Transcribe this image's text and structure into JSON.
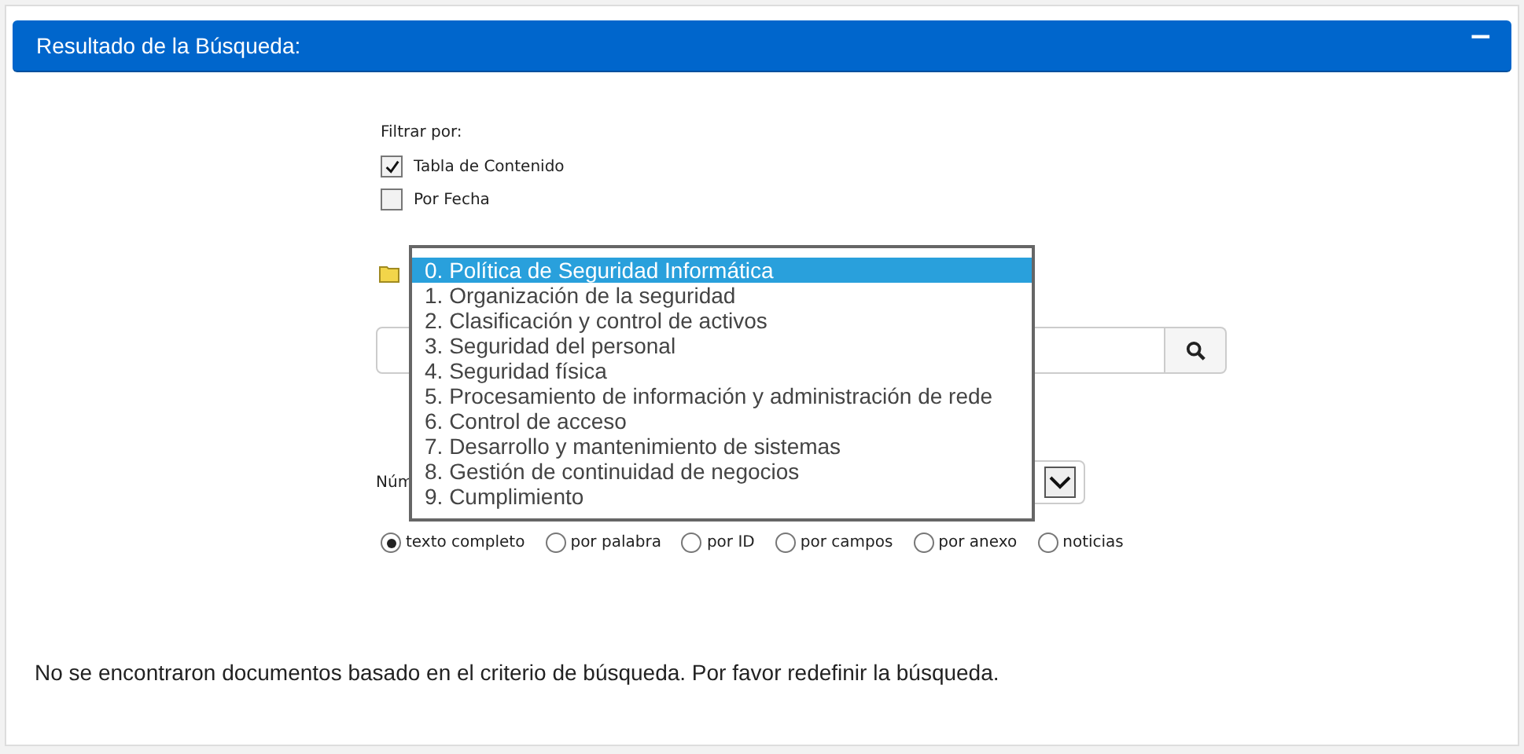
{
  "panel": {
    "title": "Resultado de la Búsqueda:",
    "collapse_icon": "−"
  },
  "filter": {
    "label": "Filtrar por:",
    "options": [
      {
        "label": "Tabla de Contenido",
        "checked": true
      },
      {
        "label": "Por Fecha",
        "checked": false
      }
    ]
  },
  "category_list": [
    {
      "label": "0. Política de Seguridad Informática",
      "selected": true
    },
    {
      "label": "1. Organización de la seguridad",
      "selected": false
    },
    {
      "label": "2. Clasificación y control de activos",
      "selected": false
    },
    {
      "label": "3. Seguridad del personal",
      "selected": false
    },
    {
      "label": "4. Seguridad física",
      "selected": false
    },
    {
      "label": "5. Procesamiento de información y administración de rede",
      "selected": false
    },
    {
      "label": "6. Control de acceso",
      "selected": false
    },
    {
      "label": "7. Desarrollo y mantenimiento de sistemas",
      "selected": false
    },
    {
      "label": "8. Gestión de continuidad de negocios",
      "selected": false
    },
    {
      "label": "9. Cumplimiento",
      "selected": false
    }
  ],
  "number_label": "Núm",
  "search_modes": [
    {
      "label": "texto completo",
      "selected": true
    },
    {
      "label": "por palabra",
      "selected": false
    },
    {
      "label": "por ID",
      "selected": false
    },
    {
      "label": "por campos",
      "selected": false
    },
    {
      "label": "por anexo",
      "selected": false
    },
    {
      "label": "noticias",
      "selected": false
    }
  ],
  "message": "No se encontraron documentos basado en el criterio de búsqueda. Por favor redefinir la búsqueda."
}
